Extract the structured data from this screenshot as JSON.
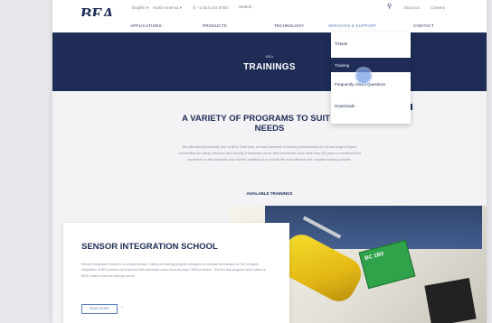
{
  "topbar": {
    "logo": "BEA",
    "language": "English ▾",
    "region": "North America ▾",
    "phone": "✆ +1 814 234 6700",
    "search_placeholder": "Search",
    "about": "About us",
    "careers": "Careers"
  },
  "nav": {
    "applications": "Applications",
    "products": "Products",
    "technology": "Technology",
    "services": "Services & Support",
    "contact": "Contact"
  },
  "hero": {
    "crumb": "BEA",
    "title": "TRAININGS"
  },
  "dropdown": {
    "items": [
      "Tickets",
      "Training",
      "Frequently Asked Questions",
      "Downloads"
    ]
  },
  "intro": {
    "headline_line1": "A VARIETY OF PROGRAMS TO SUIT YOUR",
    "headline_line2": "NEEDS",
    "lead": "We take training seriously here at BEA. Each year, we train hundreds of industry professionals on a broad range of topics surrounding the safety, detection and security of automatic doors. BEA technicians have more than 100 years of combined field experience in the automatic door market, enabling us to provide the most effective and complete training possible.",
    "available": "AVAILABLE TRAININGS"
  },
  "card": {
    "title": "SENSOR INTEGRATION SCHOOL",
    "text": "Sensor Integration School is a comprehensive, hands-on training program designed to educate technicians on the complete integration of BEA sensors and devices with automatic doors from all major OEM providers. The two-day program takes place at BEA's state-of-the-art training school.",
    "read_more": "READ MORE",
    "arrow": "›"
  },
  "photo": {
    "connector_label": "BC 1B3"
  },
  "colors": {
    "brand_navy": "#1e2c56",
    "accent_blue": "#5b7fc0"
  }
}
